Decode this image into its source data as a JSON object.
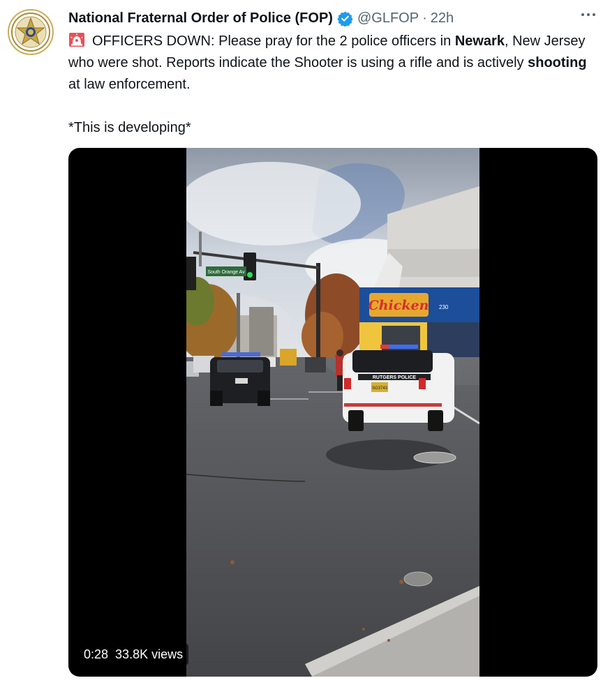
{
  "tweet": {
    "author_name": "National Fraternal Order of Police (FOP)",
    "handle": "@GLFOP",
    "separator": "·",
    "time": "22h",
    "text": {
      "prefix": "OFFICERS DOWN: Please pray for the 2 police officers in ",
      "bold_1": "Newark",
      "mid_1": ", New Jersey who were shot. Reports indicate the Shooter is using a rifle and is actively ",
      "bold_2": "shooting",
      "suffix": " at law enforcement.",
      "developing": "*This is developing*"
    },
    "icons": {
      "avatar": "fop-star-seal-icon",
      "verified": "verified-badge-icon",
      "alert": "police-siren-emoji-icon",
      "more": "more-options-icon"
    },
    "colors": {
      "verified_blue": "#1d9bf0",
      "secondary_text": "#536471"
    }
  },
  "video": {
    "duration": "0:28",
    "views": "33.8K views",
    "scene": {
      "street_sign": "South Orange Av",
      "shop_sign": "Chicken",
      "shop_number": "230",
      "car_label": "RUTGERS POLICE",
      "plate": "SG3743"
    }
  }
}
